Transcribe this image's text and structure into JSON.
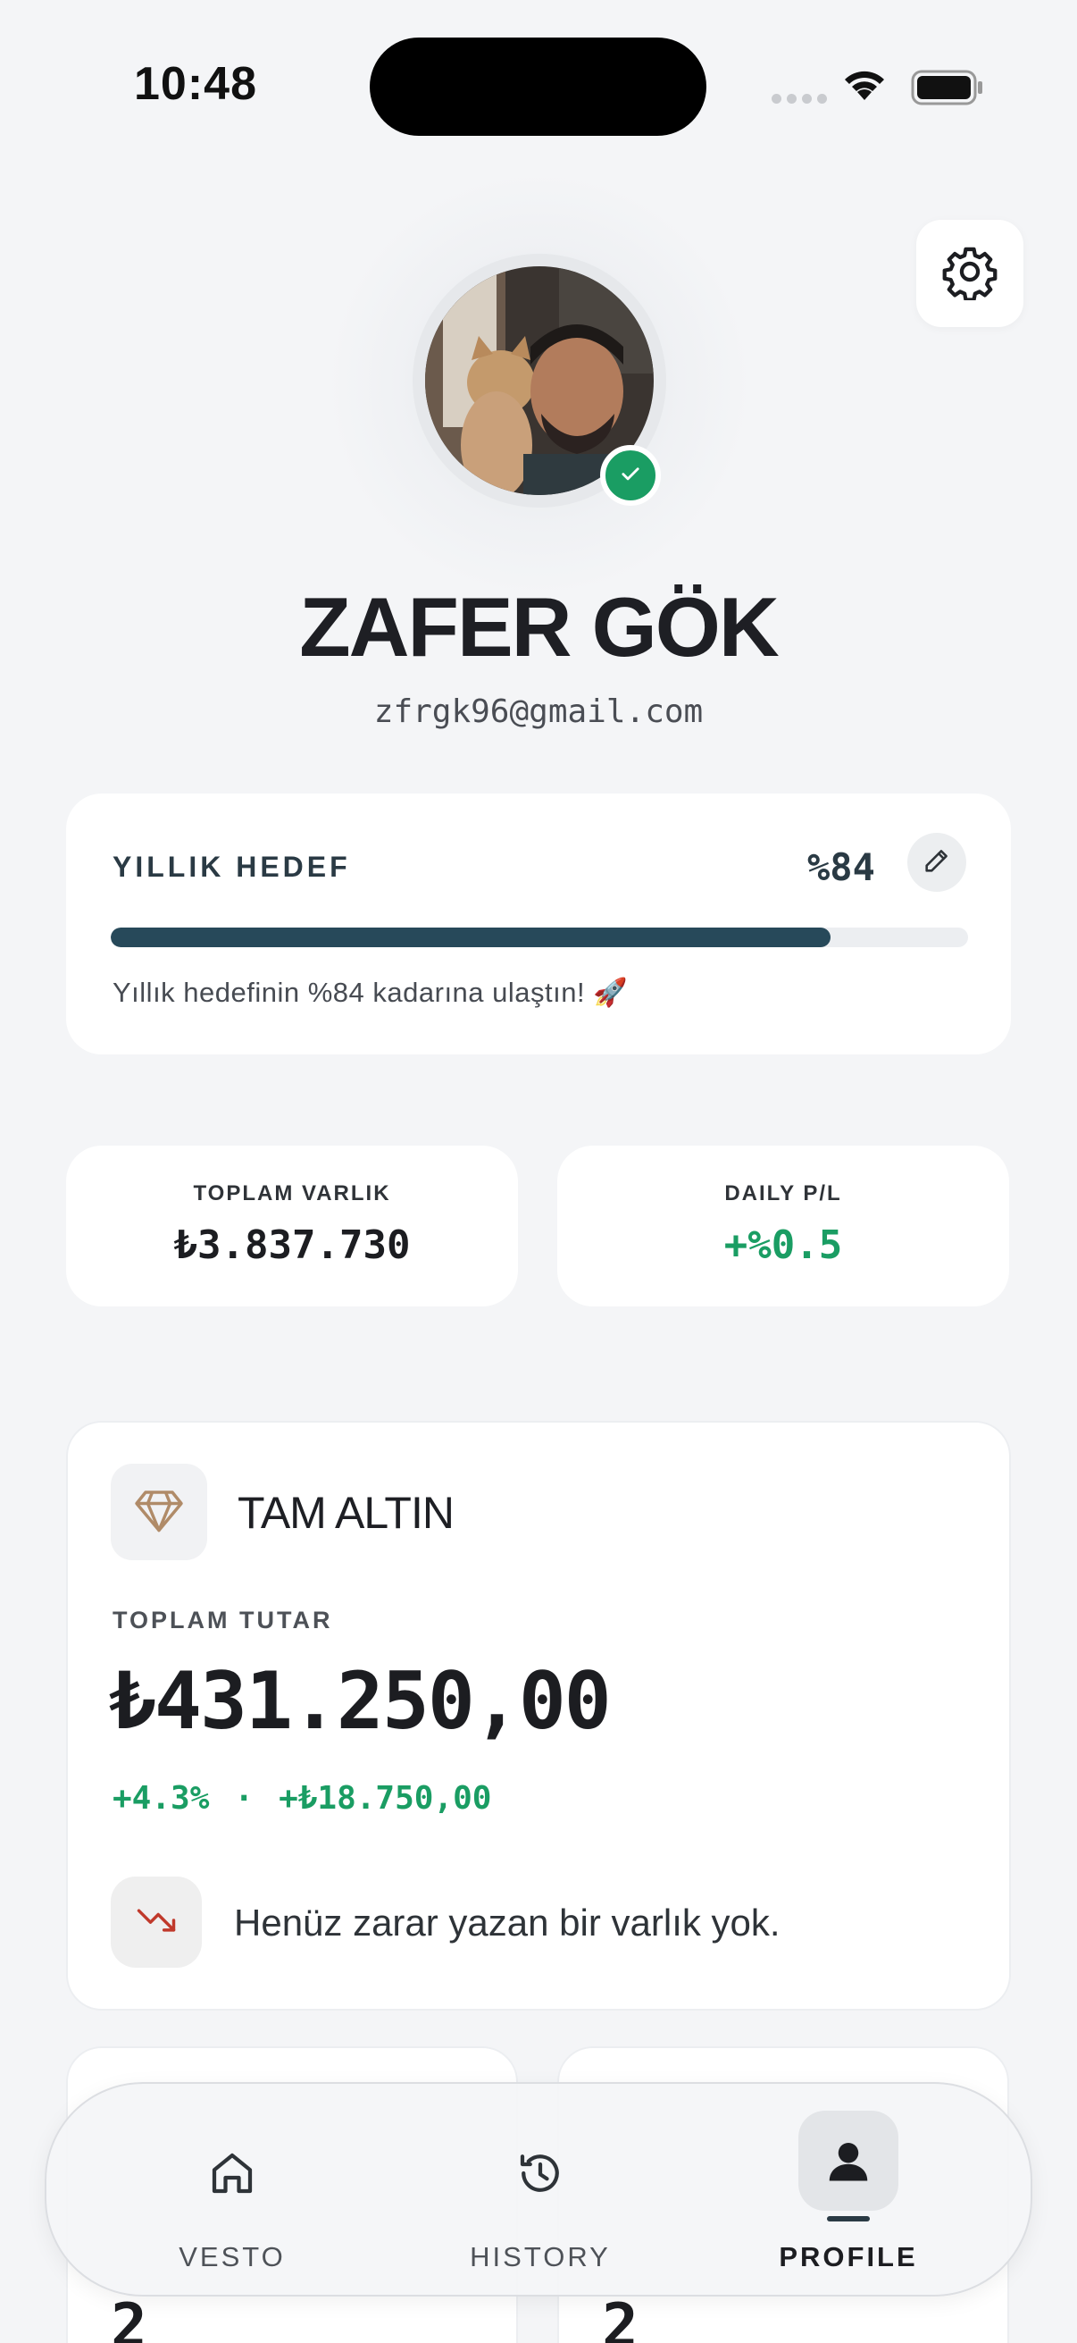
{
  "status_bar": {
    "time": "10:48"
  },
  "profile": {
    "name": "ZAFER GÖK",
    "email": "zfrgk96@gmail.com",
    "verified": true
  },
  "goal": {
    "title": "YILLIK HEDEF",
    "percent_label": "%84",
    "progress": 0.84,
    "message": "Yıllık hedefinin %84 kadarına ulaştın! 🚀"
  },
  "stats": {
    "total_assets": {
      "label": "TOPLAM VARLIK",
      "value": "₺3.837.730"
    },
    "daily_pl": {
      "label": "DAILY P/L",
      "value": "+%0.5"
    }
  },
  "asset": {
    "name": "TAM ALTIN",
    "icon": "diamond-icon",
    "total_label": "TOPLAM TUTAR",
    "total_value": "₺431.250,00",
    "change_pct": "+4.3%",
    "separator": "·",
    "change_amount": "+₺18.750,00",
    "loss_message": "Henüz zarar yazan bir varlık yok."
  },
  "peek_cards": [
    {
      "value": "2"
    },
    {
      "value": "2"
    }
  ],
  "tabs": [
    {
      "label": "VESTO",
      "icon": "home-icon",
      "active": false
    },
    {
      "label": "HISTORY",
      "icon": "history-icon",
      "active": false
    },
    {
      "label": "PROFILE",
      "icon": "profile-icon",
      "active": true
    }
  ],
  "colors": {
    "accent": "#27495a",
    "positive": "#1a9d63",
    "negative": "#c0392b",
    "background": "#f4f5f7"
  }
}
